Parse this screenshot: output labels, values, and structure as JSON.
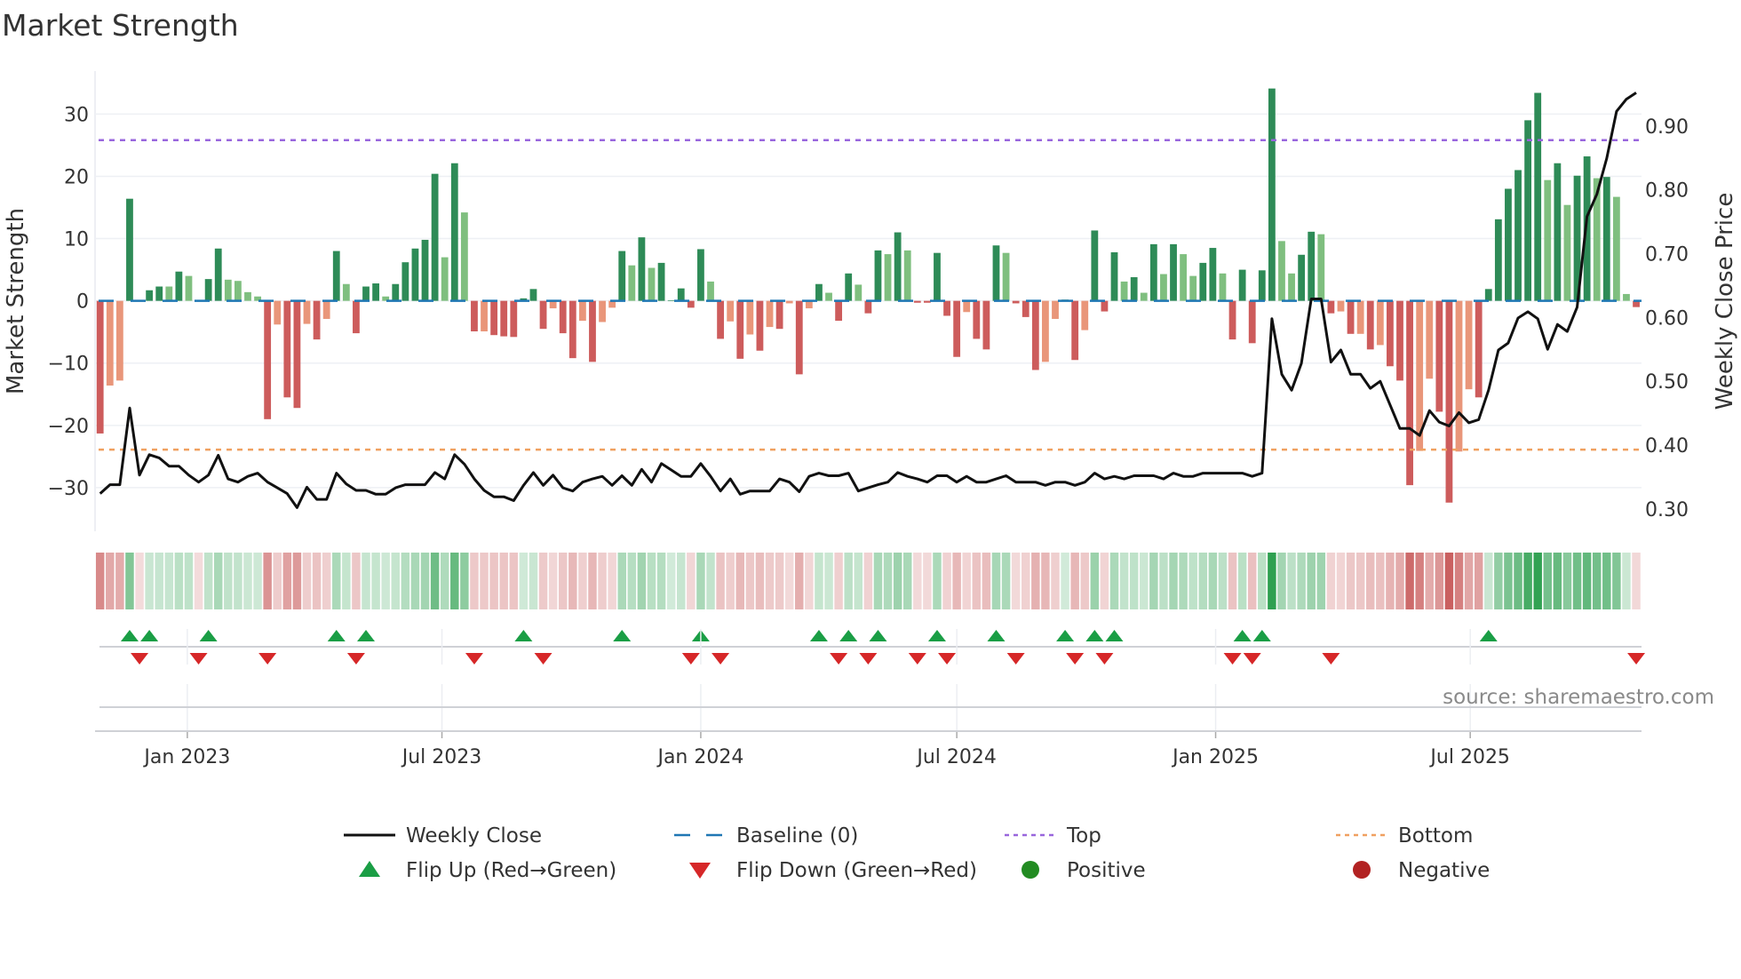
{
  "chart_data": {
    "type": "bar",
    "title": "Market Strength",
    "ylabel": "Market Strength",
    "y2label": "Weekly Close Price",
    "ylim": [
      -37,
      36.9
    ],
    "y2lim": [
      0.265,
      0.986
    ],
    "yticks": [
      -30,
      -20,
      -10,
      0,
      10,
      20,
      30
    ],
    "y2ticks": [
      0.3,
      0.4,
      0.5,
      0.6,
      0.7,
      0.8,
      0.9
    ],
    "grid": true,
    "start_date": "2022-10-31",
    "interval_days": 7,
    "xticks": [
      {
        "date": "2023-01-01",
        "label": "Jan 2023"
      },
      {
        "date": "2023-07-01",
        "label": "Jul 2023"
      },
      {
        "date": "2024-01-01",
        "label": "Jan 2024"
      },
      {
        "date": "2024-07-01",
        "label": "Jul 2024"
      },
      {
        "date": "2025-01-01",
        "label": "Jan 2025"
      },
      {
        "date": "2025-07-01",
        "label": "Jul 2025"
      }
    ],
    "top_level": 25.8,
    "bottom_level": -23.9,
    "baseline": 0,
    "strength": [
      -21.3,
      -13.6,
      -12.8,
      16.4,
      -0.1,
      1.7,
      2.3,
      2.3,
      4.7,
      4.0,
      -0.1,
      3.5,
      8.4,
      3.4,
      3.2,
      1.4,
      0.7,
      -19.0,
      -3.8,
      -15.5,
      -17.2,
      -3.7,
      -6.2,
      -2.9,
      8.0,
      2.7,
      -5.2,
      2.3,
      2.8,
      0.7,
      2.7,
      6.2,
      8.4,
      9.8,
      20.4,
      7.0,
      22.1,
      14.2,
      -4.9,
      -4.9,
      -5.5,
      -5.7,
      -5.8,
      0.4,
      1.9,
      -4.5,
      -1.2,
      -5.2,
      -9.2,
      -3.2,
      -9.8,
      -3.4,
      -1.1,
      8.0,
      5.7,
      10.2,
      5.3,
      6.1,
      0.1,
      2.0,
      -1.1,
      8.3,
      3.1,
      -6.1,
      -3.3,
      -9.3,
      -5.4,
      -8.0,
      -4.2,
      -4.5,
      -0.4,
      -11.8,
      -1.2,
      2.7,
      1.3,
      -3.2,
      4.4,
      2.6,
      -2.0,
      8.1,
      7.5,
      11.0,
      8.1,
      -0.3,
      -0.3,
      7.7,
      -2.4,
      -9.0,
      -1.8,
      -6.1,
      -7.8,
      8.9,
      7.7,
      -0.4,
      -2.6,
      -11.1,
      -9.8,
      -2.9,
      0.2,
      -9.5,
      -4.7,
      11.3,
      -1.7,
      7.8,
      3.1,
      3.8,
      1.3,
      9.1,
      4.3,
      9.1,
      7.5,
      4.0,
      6.1,
      8.5,
      4.4,
      -6.2,
      5.0,
      -6.8,
      4.9,
      34.1,
      9.6,
      4.4,
      7.4,
      11.1,
      10.7,
      -2.0,
      -1.7,
      -5.3,
      -5.3,
      -7.8,
      -7.1,
      -10.5,
      -12.8,
      -29.6,
      -24.1,
      -12.5,
      -17.8,
      -32.4,
      -24.2,
      -14.2,
      -15.5,
      1.9,
      13.1,
      18.0,
      21.0,
      29.0,
      33.4,
      19.4,
      22.1,
      15.4,
      20.1,
      23.2,
      19.7,
      19.9,
      16.7,
      1.1,
      -1.0
    ],
    "shades": "DLLDDDDLDLDDDLLLLDLDDLDLDLDDDLDDDDDLDLDLDDDDDDLDDLDLLDLDLDDDDDLDLDLDLDLDLDLDDLDDLDLDDDDDLDDDLDDDLLDDLDDDLDLDLDLLDDLDDDDDLLDDLDLDLDLDDDLLDDLLDDDDDDDLDLDDLDLLD",
    "weekly_close": [
      0.324,
      0.338,
      0.338,
      0.458,
      0.353,
      0.385,
      0.38,
      0.367,
      0.367,
      0.353,
      0.342,
      0.353,
      0.384,
      0.347,
      0.342,
      0.351,
      0.356,
      0.342,
      0.333,
      0.324,
      0.302,
      0.334,
      0.315,
      0.315,
      0.356,
      0.339,
      0.329,
      0.329,
      0.323,
      0.323,
      0.333,
      0.338,
      0.338,
      0.338,
      0.357,
      0.347,
      0.385,
      0.37,
      0.347,
      0.329,
      0.319,
      0.319,
      0.313,
      0.337,
      0.357,
      0.337,
      0.353,
      0.333,
      0.328,
      0.342,
      0.347,
      0.351,
      0.337,
      0.352,
      0.337,
      0.362,
      0.342,
      0.371,
      0.361,
      0.351,
      0.351,
      0.371,
      0.351,
      0.328,
      0.347,
      0.323,
      0.328,
      0.328,
      0.328,
      0.347,
      0.342,
      0.327,
      0.351,
      0.356,
      0.352,
      0.352,
      0.356,
      0.328,
      0.333,
      0.338,
      0.342,
      0.357,
      0.351,
      0.347,
      0.342,
      0.352,
      0.352,
      0.342,
      0.351,
      0.342,
      0.342,
      0.347,
      0.352,
      0.342,
      0.342,
      0.342,
      0.337,
      0.342,
      0.342,
      0.337,
      0.342,
      0.356,
      0.347,
      0.351,
      0.347,
      0.352,
      0.352,
      0.352,
      0.347,
      0.356,
      0.351,
      0.351,
      0.356,
      0.356,
      0.356,
      0.356,
      0.356,
      0.351,
      0.356,
      0.598,
      0.511,
      0.486,
      0.528,
      0.629,
      0.629,
      0.53,
      0.549,
      0.511,
      0.511,
      0.489,
      0.5,
      0.463,
      0.426,
      0.426,
      0.415,
      0.454,
      0.436,
      0.43,
      0.451,
      0.435,
      0.44,
      0.486,
      0.549,
      0.56,
      0.599,
      0.609,
      0.598,
      0.55,
      0.589,
      0.578,
      0.616,
      0.758,
      0.793,
      0.849,
      0.923,
      0.942,
      0.952
    ],
    "legend": {
      "placement": "bottom",
      "items": [
        {
          "label": "Weekly Close",
          "symbol": "line"
        },
        {
          "label": "Baseline (0)",
          "symbol": "dash"
        },
        {
          "label": "Top",
          "symbol": "dot-purple"
        },
        {
          "label": "Bottom",
          "symbol": "dot-orange"
        },
        {
          "label": "Flip Up (Red→Green)",
          "symbol": "triangle-up"
        },
        {
          "label": "Flip Down (Green→Red)",
          "symbol": "triangle-down"
        },
        {
          "label": "Positive",
          "symbol": "circle-green"
        },
        {
          "label": "Negative",
          "symbol": "circle-red"
        }
      ]
    },
    "source": "source: sharemaestro.com",
    "colors": {
      "dark_green": "#2e8b57",
      "light_green": "#7fbf7f",
      "dark_red": "#cd5c5c",
      "light_red": "#e9967a",
      "line": "#111111",
      "baseline": "#1f77b4",
      "top": "#9966dd",
      "bottom": "#f0a060",
      "flip_up": "#1a9e45",
      "flip_down": "#d62728",
      "positive": "#228b22",
      "negative": "#b22222"
    }
  }
}
